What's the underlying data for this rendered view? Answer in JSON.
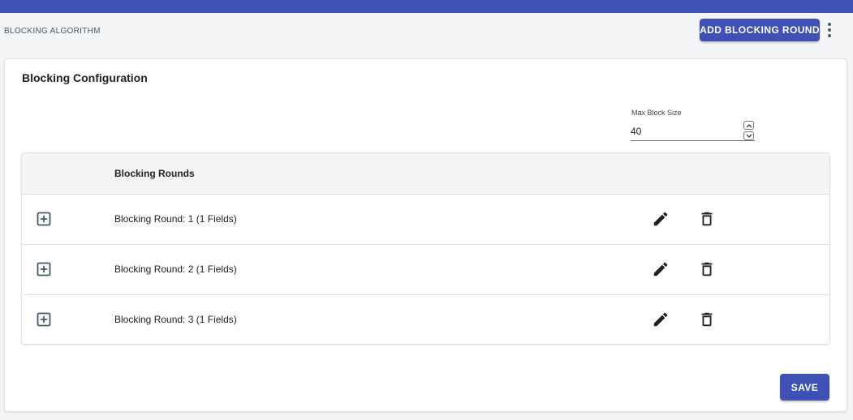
{
  "header": {
    "breadcrumb": "BLOCKING ALGORITHM",
    "add_button_label": "ADD BLOCKING ROUND",
    "more_menu_icon": "more-vert-icon"
  },
  "card": {
    "title": "Blocking Configuration",
    "max_block_size": {
      "label": "Max Block Size",
      "value": "40"
    }
  },
  "table": {
    "column_header": "Blocking Rounds",
    "rows": [
      {
        "label": "Blocking Round: 1 (1 Fields)"
      },
      {
        "label": "Blocking Round: 2 (1 Fields)"
      },
      {
        "label": "Blocking Round: 3 (1 Fields)"
      }
    ],
    "row_icons": {
      "expand": "plus-box-icon",
      "edit": "pencil-icon",
      "delete": "trash-icon"
    }
  },
  "footer": {
    "save_label": "SAVE"
  },
  "colors": {
    "primary": "#3f51b5",
    "background": "#f4f5f7",
    "icon": "#212121",
    "expand_icon": "#455a64"
  }
}
